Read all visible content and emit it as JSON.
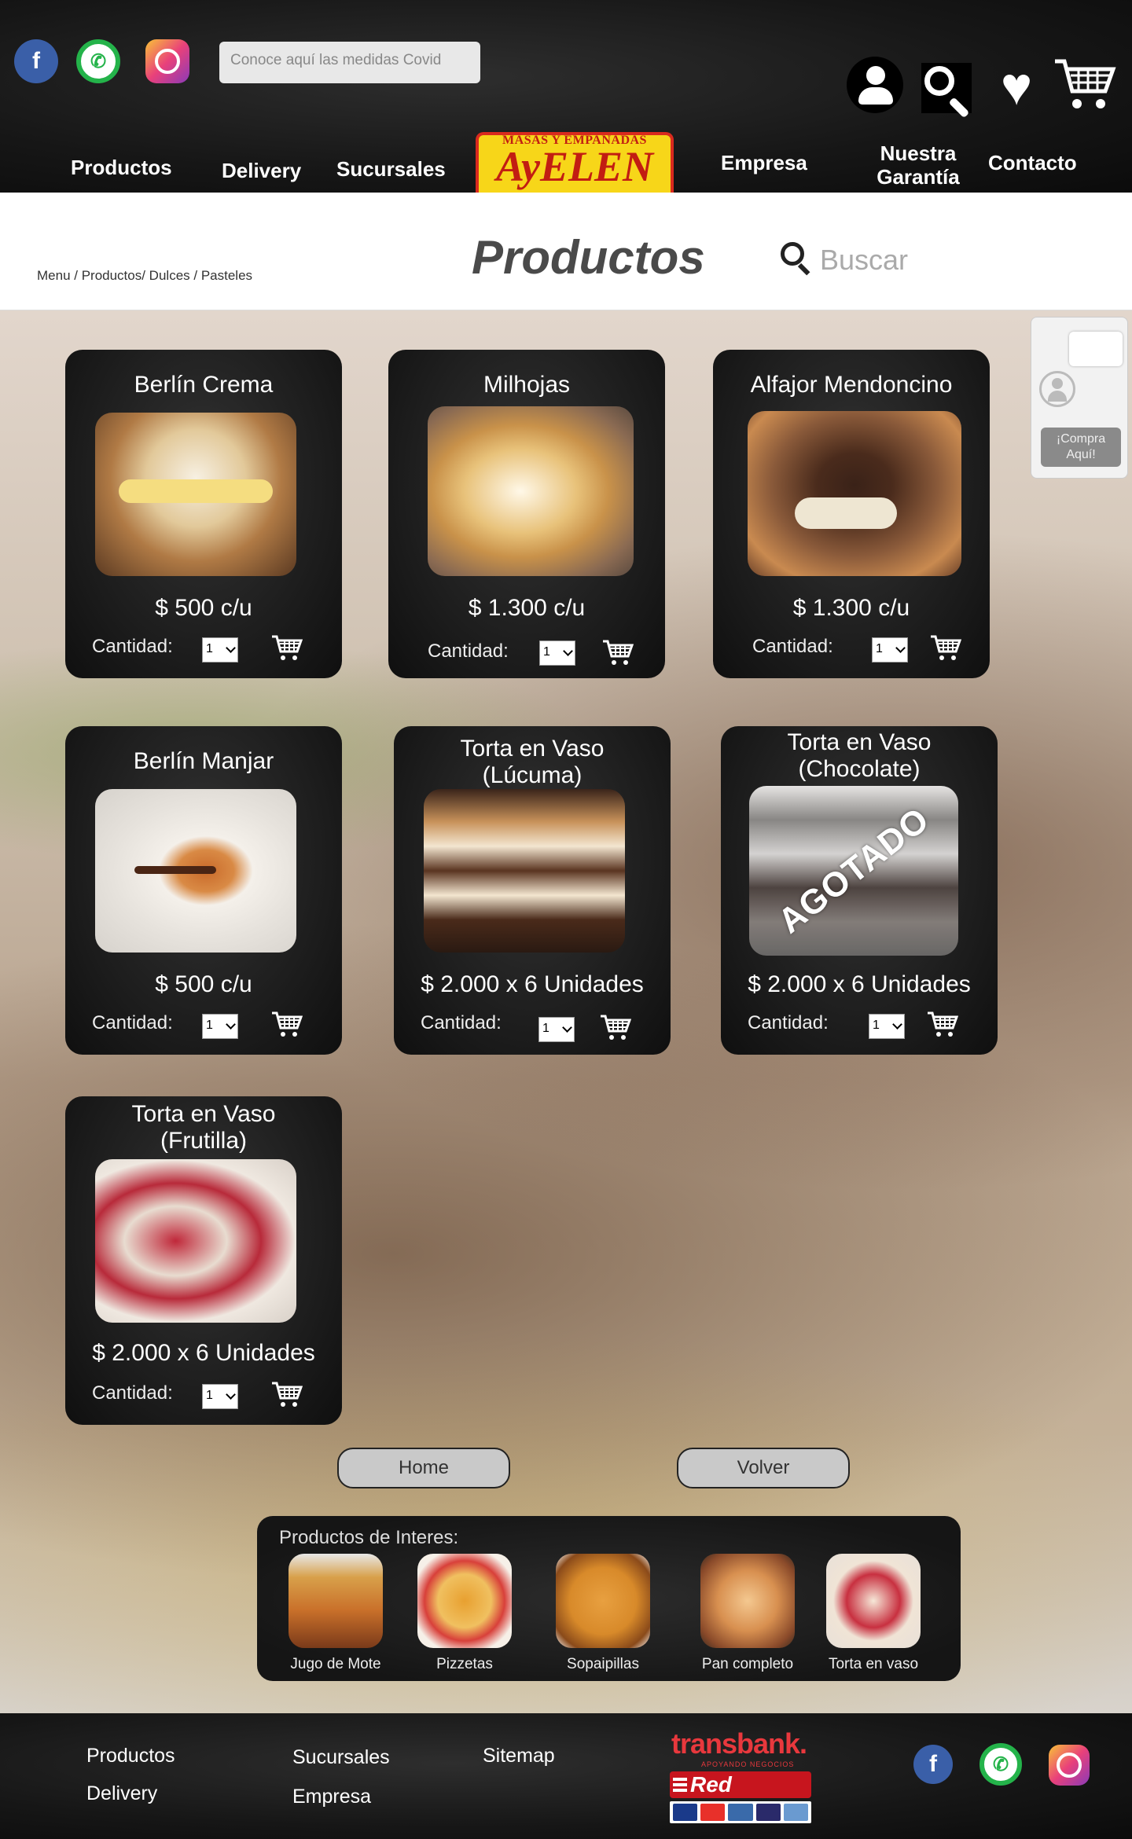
{
  "header": {
    "covid_placeholder": "Conoce aquí las medidas Covid",
    "nav_left": [
      "Productos",
      "Delivery",
      "Sucursales"
    ],
    "nav_right": [
      "Empresa",
      "Nuestra Garantía",
      "Contacto"
    ],
    "logo_small": "MASAS Y EMPANADAS",
    "logo_big": "AyELEN"
  },
  "subheader": {
    "breadcrumb": "Menu / Productos/  Dulces / Pasteles",
    "title": "Productos",
    "search_placeholder": "Buscar"
  },
  "products": [
    {
      "name": "Berlín Crema",
      "price": "$ 500 c/u",
      "qty_label": "Cantidad:",
      "qty": "1"
    },
    {
      "name": "Milhojas",
      "price": "$ 1.300 c/u",
      "qty_label": "Cantidad:",
      "qty": "1"
    },
    {
      "name": "Alfajor Mendoncino",
      "price": "$ 1.300 c/u",
      "qty_label": "Cantidad:",
      "qty": "1"
    },
    {
      "name": "Berlín Manjar",
      "price": "$ 500 c/u",
      "qty_label": "Cantidad:",
      "qty": "1"
    },
    {
      "name": "Torta en Vaso\n(Lúcuma)",
      "price": "$ 2.000  x  6 Unidades",
      "qty_label": "Cantidad:",
      "qty": "1"
    },
    {
      "name": "Torta en Vaso\n(Chocolate)",
      "price": "$ 2.000  x  6 Unidades",
      "qty_label": "Cantidad:",
      "qty": "1",
      "badge": "AGOTADO"
    },
    {
      "name": "Torta en Vaso\n(Frutilla)",
      "price": "$ 2.000  x  6 Unidades",
      "qty_label": "Cantidad:",
      "qty": "1"
    }
  ],
  "chat": {
    "label": "¡Compra Aquí!"
  },
  "buttons": {
    "home": "Home",
    "back": "Volver"
  },
  "interest": {
    "title": "Productos de Interes:",
    "items": [
      "Jugo de Mote",
      "Pizzetas",
      "Sopaipillas",
      "Pan completo",
      "Torta en vaso"
    ]
  },
  "footer": {
    "links": [
      "Productos",
      "Delivery",
      "Sucursales",
      "Empresa",
      "Sitemap"
    ],
    "transbank": "transbank.",
    "transbank_sub": "APOYANDO NEGOCIOS",
    "redcompra": "Red compra"
  },
  "colors": {
    "header_bg": "#161616",
    "logo_yellow": "#f7d619",
    "logo_red": "#d92a1e",
    "card_bg": "#1a1a1a"
  }
}
